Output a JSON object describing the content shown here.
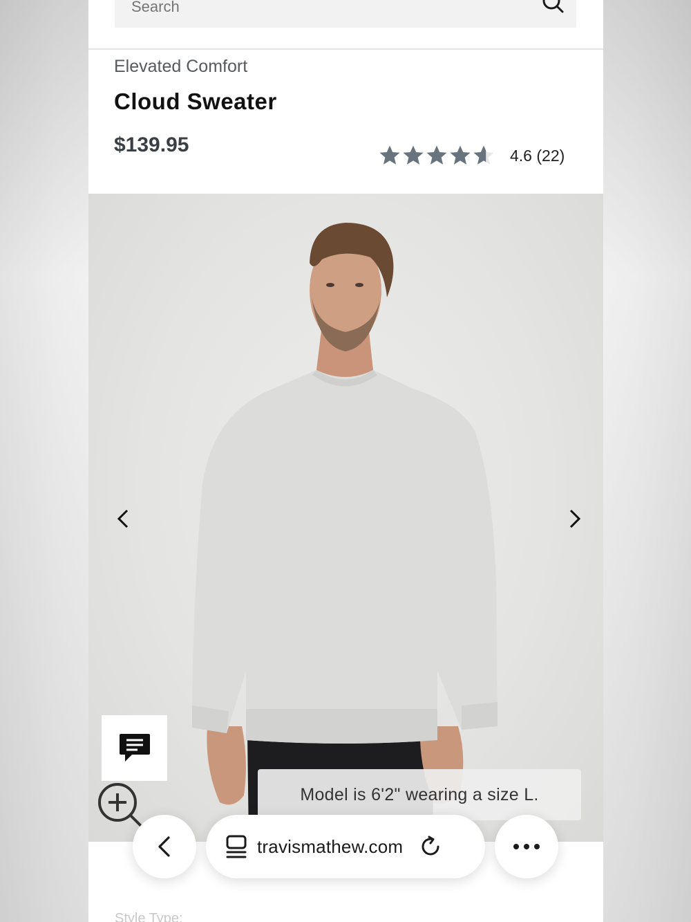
{
  "search": {
    "placeholder": "Search"
  },
  "product": {
    "eyebrow": "Elevated Comfort",
    "title": "Cloud Sweater",
    "price": "$139.95",
    "rating": {
      "value": 4.6,
      "max": 5,
      "text": "4.6 (22)"
    }
  },
  "gallery": {
    "caption": "Model is 6'2\" wearing a size L."
  },
  "below": {
    "style_type_label": "Style Type:"
  },
  "browser": {
    "url": "travismathew.com"
  },
  "colors": {
    "star": "#68737e",
    "accent": "#111111"
  }
}
